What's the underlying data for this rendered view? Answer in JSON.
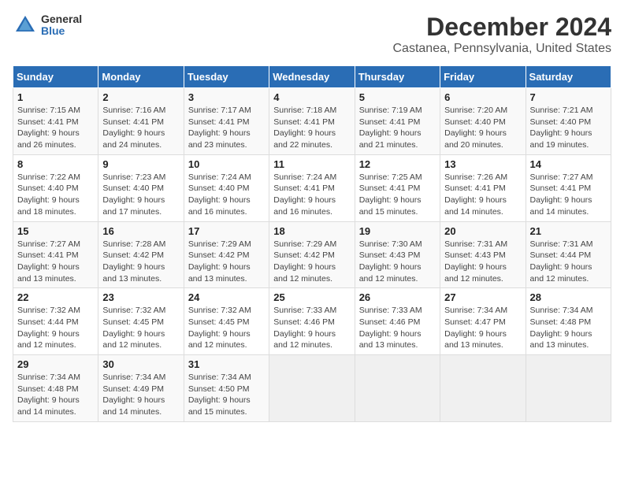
{
  "header": {
    "logo_general": "General",
    "logo_blue": "Blue",
    "title": "December 2024",
    "subtitle": "Castanea, Pennsylvania, United States"
  },
  "calendar": {
    "days_of_week": [
      "Sunday",
      "Monday",
      "Tuesday",
      "Wednesday",
      "Thursday",
      "Friday",
      "Saturday"
    ],
    "weeks": [
      [
        {
          "day": "1",
          "sunrise": "7:15 AM",
          "sunset": "4:41 PM",
          "daylight": "9 hours and 26 minutes."
        },
        {
          "day": "2",
          "sunrise": "7:16 AM",
          "sunset": "4:41 PM",
          "daylight": "9 hours and 24 minutes."
        },
        {
          "day": "3",
          "sunrise": "7:17 AM",
          "sunset": "4:41 PM",
          "daylight": "9 hours and 23 minutes."
        },
        {
          "day": "4",
          "sunrise": "7:18 AM",
          "sunset": "4:41 PM",
          "daylight": "9 hours and 22 minutes."
        },
        {
          "day": "5",
          "sunrise": "7:19 AM",
          "sunset": "4:41 PM",
          "daylight": "9 hours and 21 minutes."
        },
        {
          "day": "6",
          "sunrise": "7:20 AM",
          "sunset": "4:40 PM",
          "daylight": "9 hours and 20 minutes."
        },
        {
          "day": "7",
          "sunrise": "7:21 AM",
          "sunset": "4:40 PM",
          "daylight": "9 hours and 19 minutes."
        }
      ],
      [
        {
          "day": "8",
          "sunrise": "7:22 AM",
          "sunset": "4:40 PM",
          "daylight": "9 hours and 18 minutes."
        },
        {
          "day": "9",
          "sunrise": "7:23 AM",
          "sunset": "4:40 PM",
          "daylight": "9 hours and 17 minutes."
        },
        {
          "day": "10",
          "sunrise": "7:24 AM",
          "sunset": "4:40 PM",
          "daylight": "9 hours and 16 minutes."
        },
        {
          "day": "11",
          "sunrise": "7:24 AM",
          "sunset": "4:41 PM",
          "daylight": "9 hours and 16 minutes."
        },
        {
          "day": "12",
          "sunrise": "7:25 AM",
          "sunset": "4:41 PM",
          "daylight": "9 hours and 15 minutes."
        },
        {
          "day": "13",
          "sunrise": "7:26 AM",
          "sunset": "4:41 PM",
          "daylight": "9 hours and 14 minutes."
        },
        {
          "day": "14",
          "sunrise": "7:27 AM",
          "sunset": "4:41 PM",
          "daylight": "9 hours and 14 minutes."
        }
      ],
      [
        {
          "day": "15",
          "sunrise": "7:27 AM",
          "sunset": "4:41 PM",
          "daylight": "9 hours and 13 minutes."
        },
        {
          "day": "16",
          "sunrise": "7:28 AM",
          "sunset": "4:42 PM",
          "daylight": "9 hours and 13 minutes."
        },
        {
          "day": "17",
          "sunrise": "7:29 AM",
          "sunset": "4:42 PM",
          "daylight": "9 hours and 13 minutes."
        },
        {
          "day": "18",
          "sunrise": "7:29 AM",
          "sunset": "4:42 PM",
          "daylight": "9 hours and 12 minutes."
        },
        {
          "day": "19",
          "sunrise": "7:30 AM",
          "sunset": "4:43 PM",
          "daylight": "9 hours and 12 minutes."
        },
        {
          "day": "20",
          "sunrise": "7:31 AM",
          "sunset": "4:43 PM",
          "daylight": "9 hours and 12 minutes."
        },
        {
          "day": "21",
          "sunrise": "7:31 AM",
          "sunset": "4:44 PM",
          "daylight": "9 hours and 12 minutes."
        }
      ],
      [
        {
          "day": "22",
          "sunrise": "7:32 AM",
          "sunset": "4:44 PM",
          "daylight": "9 hours and 12 minutes."
        },
        {
          "day": "23",
          "sunrise": "7:32 AM",
          "sunset": "4:45 PM",
          "daylight": "9 hours and 12 minutes."
        },
        {
          "day": "24",
          "sunrise": "7:32 AM",
          "sunset": "4:45 PM",
          "daylight": "9 hours and 12 minutes."
        },
        {
          "day": "25",
          "sunrise": "7:33 AM",
          "sunset": "4:46 PM",
          "daylight": "9 hours and 12 minutes."
        },
        {
          "day": "26",
          "sunrise": "7:33 AM",
          "sunset": "4:46 PM",
          "daylight": "9 hours and 13 minutes."
        },
        {
          "day": "27",
          "sunrise": "7:34 AM",
          "sunset": "4:47 PM",
          "daylight": "9 hours and 13 minutes."
        },
        {
          "day": "28",
          "sunrise": "7:34 AM",
          "sunset": "4:48 PM",
          "daylight": "9 hours and 13 minutes."
        }
      ],
      [
        {
          "day": "29",
          "sunrise": "7:34 AM",
          "sunset": "4:48 PM",
          "daylight": "9 hours and 14 minutes."
        },
        {
          "day": "30",
          "sunrise": "7:34 AM",
          "sunset": "4:49 PM",
          "daylight": "9 hours and 14 minutes."
        },
        {
          "day": "31",
          "sunrise": "7:34 AM",
          "sunset": "4:50 PM",
          "daylight": "9 hours and 15 minutes."
        },
        null,
        null,
        null,
        null
      ]
    ],
    "labels": {
      "sunrise": "Sunrise:",
      "sunset": "Sunset:",
      "daylight": "Daylight:"
    }
  }
}
